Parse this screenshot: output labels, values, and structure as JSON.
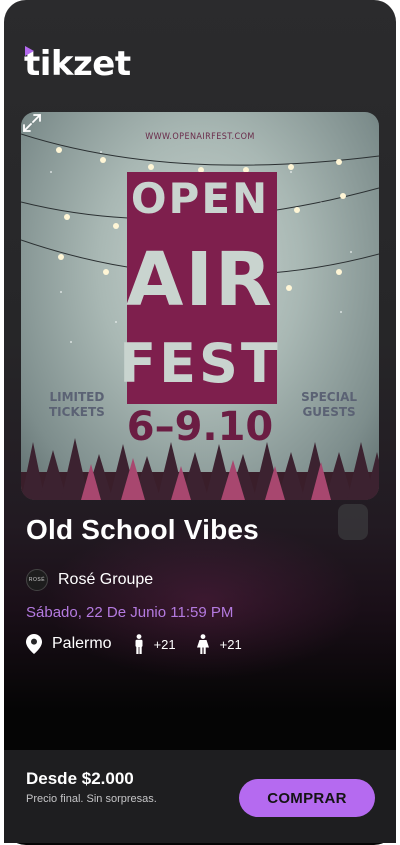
{
  "app": {
    "logo_text": "tikzet",
    "accent_color": "#b56af0"
  },
  "poster": {
    "url_text": "WWW.OPENAIRFEST.COM",
    "word_1": "OPEN",
    "word_2": "AIR",
    "word_3": "FEST",
    "dates": "6–9.10",
    "left_text_1": "LIMITED",
    "left_text_2": "TICKETS",
    "right_text_1": "SPECIAL",
    "right_text_2": "GUESTS",
    "expand_icon": "expand-icon"
  },
  "event": {
    "title": "Old School Vibes",
    "organizer": {
      "avatar_text": "ROSÉ",
      "name": "Rosé Groupe"
    },
    "date_text": "Sábado, 22 De Junio 11:59 PM",
    "location": "Palermo",
    "age_male": "+21",
    "age_female": "+21"
  },
  "purchase": {
    "price": "Desde $2.000",
    "price_note": "Precio final. Sin sorpresas.",
    "button_label": "COMPRAR"
  }
}
